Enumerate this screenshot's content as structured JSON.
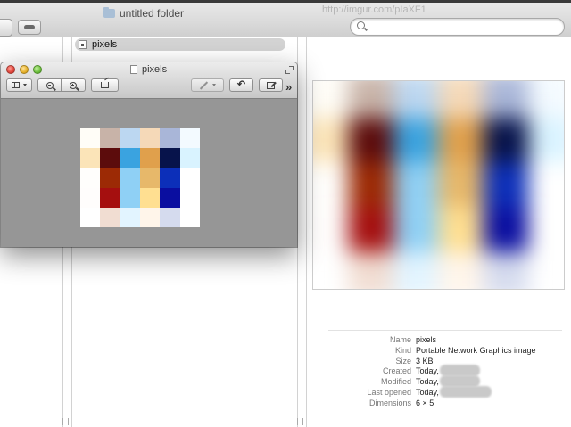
{
  "finder": {
    "folder_title": "untitled folder",
    "url_ghost": "http://imgur.com/pIaXF1",
    "search_placeholder": "",
    "selected_file": "pixels"
  },
  "preview_window": {
    "title": "pixels",
    "toolbar": {
      "sidebar": "sidebar-icon",
      "zoom_out": "zoom-out-icon",
      "zoom_in": "zoom-in-icon",
      "share": "share-icon",
      "annotate": "annotate-icon",
      "rotate": "rotate-icon",
      "edit": "edit-icon",
      "more": "»"
    }
  },
  "image_pixels": [
    [
      "#fffdf7",
      "#c8b3a8",
      "#bcd7f1",
      "#f5d9b8",
      "#a9b6d8",
      "#f3faff"
    ],
    [
      "#fbe4b8",
      "#5c0c0c",
      "#3aa3e0",
      "#e0a04c",
      "#07134b",
      "#d9f3ff"
    ],
    [
      "#fffefc",
      "#9c2a05",
      "#8fd0f5",
      "#e7b86a",
      "#0c2fb9",
      "#ffffff"
    ],
    [
      "#fffdfc",
      "#a50f0f",
      "#8fd0f5",
      "#ffdf91",
      "#0a0ea0",
      "#ffffff"
    ],
    [
      "#ffffff",
      "#f1ddd2",
      "#e2f4ff",
      "#fff5ea",
      "#d5dbee",
      "#ffffff"
    ]
  ],
  "info": [
    {
      "key": "Name",
      "value": "pixels"
    },
    {
      "key": "Kind",
      "value": "Portable Network Graphics image"
    },
    {
      "key": "Size",
      "value": "3 KB"
    },
    {
      "key": "Created",
      "value": "Today,"
    },
    {
      "key": "Modified",
      "value": "Today,"
    },
    {
      "key": "Last opened",
      "value": "Today,"
    },
    {
      "key": "Dimensions",
      "value": "6 × 5"
    }
  ]
}
